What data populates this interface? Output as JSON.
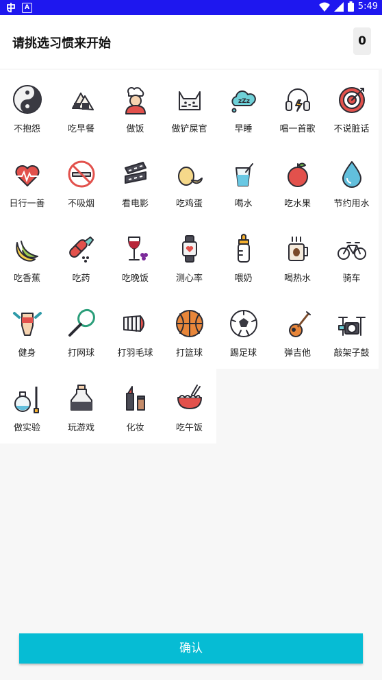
{
  "status_bar": {
    "time": "5:49"
  },
  "header": {
    "title": "请挑选习惯来开始",
    "selected_count": "0"
  },
  "habits": [
    {
      "label": "不抱怨",
      "icon": "yin-yang-icon"
    },
    {
      "label": "吃早餐",
      "icon": "rice-ball-icon"
    },
    {
      "label": "做饭",
      "icon": "chef-icon"
    },
    {
      "label": "做铲屎官",
      "icon": "cat-icon"
    },
    {
      "label": "早睡",
      "icon": "sleep-cloud-icon"
    },
    {
      "label": "唱一首歌",
      "icon": "headphones-icon"
    },
    {
      "label": "不说脏话",
      "icon": "target-icon"
    },
    {
      "label": "日行一善",
      "icon": "heartbeat-icon"
    },
    {
      "label": "不吸烟",
      "icon": "no-smoking-icon"
    },
    {
      "label": "看电影",
      "icon": "film-strip-icon"
    },
    {
      "label": "吃鸡蛋",
      "icon": "egg-icon"
    },
    {
      "label": "喝水",
      "icon": "water-glass-icon"
    },
    {
      "label": "吃水果",
      "icon": "apple-icon"
    },
    {
      "label": "节约用水",
      "icon": "water-drop-icon"
    },
    {
      "label": "吃香蕉",
      "icon": "banana-icon"
    },
    {
      "label": "吃药",
      "icon": "pill-icon"
    },
    {
      "label": "吃晚饭",
      "icon": "wine-grapes-icon"
    },
    {
      "label": "测心率",
      "icon": "smartwatch-icon"
    },
    {
      "label": "喂奶",
      "icon": "baby-bottle-icon"
    },
    {
      "label": "喝热水",
      "icon": "hot-mug-icon"
    },
    {
      "label": "骑车",
      "icon": "bicycle-icon"
    },
    {
      "label": "健身",
      "icon": "fitness-icon"
    },
    {
      "label": "打网球",
      "icon": "tennis-racket-icon"
    },
    {
      "label": "打羽毛球",
      "icon": "shuttlecock-icon"
    },
    {
      "label": "打篮球",
      "icon": "basketball-icon"
    },
    {
      "label": "踢足球",
      "icon": "soccer-ball-icon"
    },
    {
      "label": "弹吉他",
      "icon": "guitar-icon"
    },
    {
      "label": "敲架子鼓",
      "icon": "drum-kit-icon"
    },
    {
      "label": "做实验",
      "icon": "flask-icon"
    },
    {
      "label": "玩游戏",
      "icon": "potion-bottle-icon"
    },
    {
      "label": "化妆",
      "icon": "lipstick-icon"
    },
    {
      "label": "吃午饭",
      "icon": "noodle-bowl-icon"
    }
  ],
  "confirm_label": "确认",
  "colors": {
    "status_bar": "#1e17ef",
    "confirm_button": "#06bcd4"
  }
}
